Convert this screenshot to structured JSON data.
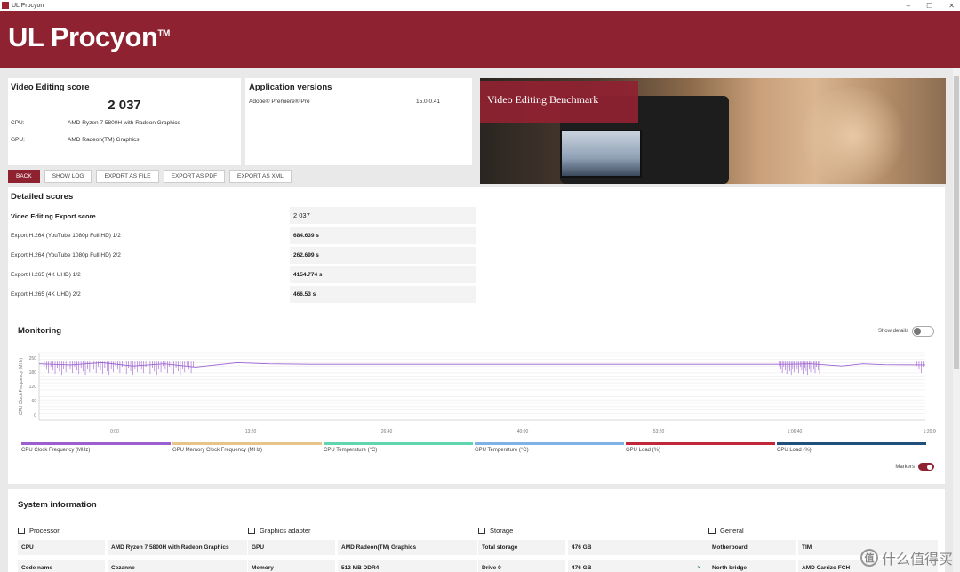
{
  "window": {
    "title": "UL Procyon",
    "minimize": "–",
    "maximize": "☐",
    "close": "✕"
  },
  "header": {
    "logo": "UL Procyon",
    "tm": "TM"
  },
  "score": {
    "title": "Video Editing score",
    "value": "2 037",
    "cpu_label": "CPU:",
    "cpu_value": "AMD Ryzen 7 5800H with Radeon Graphics",
    "gpu_label": "GPU:",
    "gpu_value": "AMD Radeon(TM) Graphics"
  },
  "apps": {
    "title": "Application versions",
    "items": [
      {
        "name": "Adobe® Premiere® Pro",
        "version": "15.0.0.41"
      }
    ]
  },
  "banner": {
    "title": "Video Editing Benchmark"
  },
  "buttons": {
    "back": "BACK",
    "show_log": "SHOW LOG",
    "export_file": "EXPORT AS FILE",
    "export_pdf": "EXPORT AS PDF",
    "export_xml": "EXPORT AS XML"
  },
  "detailed": {
    "title": "Detailed scores",
    "rows": [
      {
        "label": "Video Editing Export score",
        "value": "2 037"
      },
      {
        "label": "Export H.264 (YouTube 1080p Full HD) 1/2",
        "value": "684.639 s"
      },
      {
        "label": "Export H.264 (YouTube 1080p Full HD) 2/2",
        "value": "262.699 s"
      },
      {
        "label": "Export H.265 (4K UHD) 1/2",
        "value": "4154.774 s"
      },
      {
        "label": "Export H.265 (4K UHD) 2/2",
        "value": "466.53 s"
      }
    ]
  },
  "monitoring": {
    "title": "Monitoring",
    "show_details": "Show details",
    "markers": "Markers",
    "legend": [
      {
        "label": "CPU Clock Frequency (MHz)",
        "color": "#9b5fd0"
      },
      {
        "label": "GPU Memory Clock Frequency (MHz)",
        "color": "#e6c58a"
      },
      {
        "label": "CPU Temperature (°C)",
        "color": "#5fd6b0"
      },
      {
        "label": "GPU Temperature (°C)",
        "color": "#7fb3e6"
      },
      {
        "label": "GPU Load (%)",
        "color": "#c0283a"
      },
      {
        "label": "CPU Load (%)",
        "color": "#1f4f7a"
      }
    ]
  },
  "chart_data": {
    "type": "line",
    "title": "",
    "ylabel": "CPU Clock Frequency (MHz)",
    "y_tick_labels": [
      "250",
      "180",
      "120",
      "60",
      "0"
    ],
    "x_tick_labels": [
      "0:00",
      "13:20",
      "26:40",
      "40:00",
      "53:20",
      "1:06:40",
      "1:20:00"
    ],
    "series": [
      {
        "name": "CPU Clock Frequency (MHz)",
        "x": [
          0,
          3,
          6,
          9,
          12,
          15,
          19,
          22,
          26,
          30,
          40,
          50,
          60,
          70,
          72,
          74,
          77,
          79,
          81,
          85
        ],
        "values": [
          250,
          245,
          255,
          240,
          250,
          235,
          255,
          250,
          248,
          248,
          248,
          248,
          248,
          248,
          248,
          250,
          240,
          250,
          246,
          245
        ]
      }
    ]
  },
  "system": {
    "title": "System information",
    "columns": [
      {
        "title": "Processor",
        "icon": "processor-icon",
        "rows": [
          {
            "k": "CPU",
            "v": "AMD Ryzen 7 5800H with Radeon Graphics"
          },
          {
            "k": "Code name",
            "v": "Cezanne"
          }
        ]
      },
      {
        "title": "Graphics adapter",
        "icon": "graphics-icon",
        "rows": [
          {
            "k": "GPU",
            "v": "AMD Radeon(TM) Graphics"
          },
          {
            "k": "Memory",
            "v": "512 MB DDR4"
          }
        ]
      },
      {
        "title": "Storage",
        "icon": "storage-icon",
        "rows": [
          {
            "k": "Total storage",
            "v": "476 GB"
          },
          {
            "k": "Drive 0",
            "v": "476 GB"
          }
        ]
      },
      {
        "title": "General",
        "icon": "general-icon",
        "rows": [
          {
            "k": "Motherboard",
            "v": "TIM"
          },
          {
            "k": "North bridge",
            "v": "AMD Carrizo FCH"
          }
        ]
      }
    ]
  },
  "watermark": {
    "symbol": "值",
    "text": "什么值得买"
  }
}
